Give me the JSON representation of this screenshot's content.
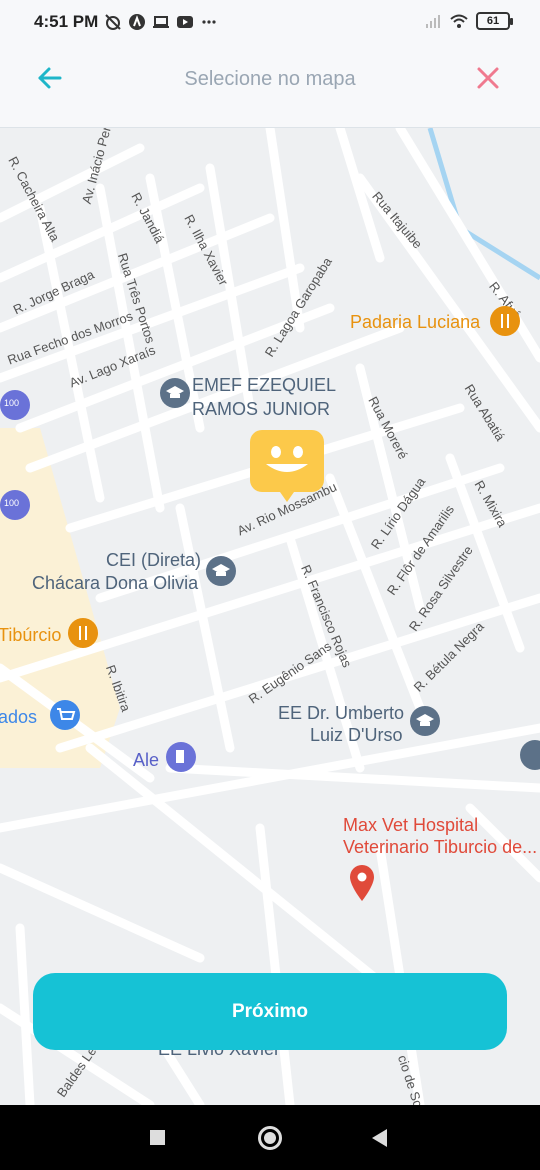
{
  "status_bar": {
    "time": "4:51 PM",
    "battery": "61",
    "icons": [
      "muted-alarm-icon",
      "app-icon",
      "laptop-icon",
      "youtube-icon",
      "more-dots-icon",
      "signal-icon",
      "wifi-icon",
      "battery-icon"
    ]
  },
  "header": {
    "title": "Selecione no mapa",
    "back_icon": "arrow-left-icon",
    "close_icon": "close-icon",
    "accent_color": "#1fb6c9",
    "close_color": "#f07a8f"
  },
  "map": {
    "streets": [
      "R. Cacheira Alta",
      "Av. Inácio Penteado",
      "R. Jandiá",
      "R. Ilha Xavier",
      "Rua Três Portos",
      "Rua Itajuibe",
      "R. Jorge Braga",
      "Rua Fecho dos Morros",
      "Av. Lago Xaraís",
      "R. Lagoa Garopaba",
      "R. Afuá",
      "Rua Abatiá",
      "Rua Moreré",
      "Av. Rio Mossambu",
      "R. Lírio Dágua",
      "R. Mixira",
      "R. Flôr de Amarilis",
      "R. Rosa Silvestre",
      "R. Francisco Rojas",
      "R. Bétula Negra",
      "R. Eugênio Sans",
      "R. Ibitira",
      "Baldes Le",
      "cio de Sou"
    ],
    "pois": {
      "padaria": "Padaria Luciana",
      "emef_line1": "EMEF EZEQUIEL",
      "emef_line2": "RAMOS JUNIOR",
      "cei_line1": "CEI (Direta)",
      "cei_line2": "Chácara Dona Olivia",
      "tiburcio": "Tibúrcio",
      "ados": "ados",
      "ale": "Ale",
      "ee_line1": "EE Dr. Umberto",
      "ee_line2": "Luiz D'Urso",
      "maxvet_line1": "Max Vet Hospital",
      "maxvet_line2": "Veterinario Tiburcio de...",
      "livio": "EE Livio Xavier",
      "bus_badge": "100"
    },
    "colors": {
      "food": "#e8920f",
      "school": "#5c7188",
      "hospital": "#e04a3a",
      "shopping": "#3d87e8",
      "fuel": "#6a72d8",
      "marker": "#fcc94a"
    }
  },
  "next_button": {
    "label": "Próximo",
    "color": "#16c2d5"
  },
  "nav_bar": {
    "icons": [
      "recent-apps-icon",
      "home-icon",
      "back-icon"
    ]
  }
}
